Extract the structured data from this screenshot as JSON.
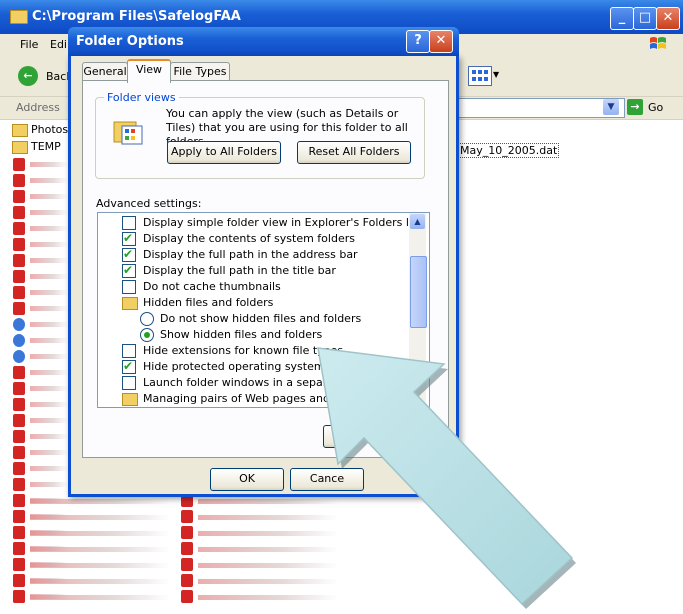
{
  "explorer": {
    "title": "C:\\Program Files\\SafelogFAA",
    "menu": [
      "File",
      "Edi"
    ],
    "toolbar": {
      "back_label": "Back"
    },
    "address_label": "Address",
    "go_label": "Go",
    "folders": [
      "Photos",
      "TEMP"
    ],
    "visible_file": "May_10_2005.dat"
  },
  "dialog": {
    "title": "Folder Options",
    "help_glyph": "?",
    "close_glyph": "✕",
    "tabs": [
      "General",
      "View",
      "File Types"
    ],
    "active_tab": "View",
    "folder_views": {
      "legend": "Folder views",
      "description": "You can apply the view (such as Details or Tiles) that you are using for this folder to all folders.",
      "apply_button": "Apply to All Folders",
      "reset_button": "Reset All Folders"
    },
    "advanced_label": "Advanced settings:",
    "settings": [
      {
        "text": "Display simple folder view in Explorer's Folders list",
        "kind": "checkbox",
        "checked": false
      },
      {
        "text": "Display the contents of system folders",
        "kind": "checkbox",
        "checked": true
      },
      {
        "text": "Display the full path in the address bar",
        "kind": "checkbox",
        "checked": true
      },
      {
        "text": "Display the full path in the title bar",
        "kind": "checkbox",
        "checked": true
      },
      {
        "text": "Do not cache thumbnails",
        "kind": "checkbox",
        "checked": false
      },
      {
        "text": "Hidden files and folders",
        "kind": "folder"
      },
      {
        "text": "Do not show hidden files and folders",
        "kind": "radio",
        "checked": false
      },
      {
        "text": "Show hidden files and folders",
        "kind": "radio",
        "checked": true
      },
      {
        "text": "Hide extensions for known file types",
        "kind": "checkbox",
        "checked": false
      },
      {
        "text": "Hide protected operating system files",
        "kind": "checkbox",
        "checked": true
      },
      {
        "text": "Launch folder windows in a separate",
        "kind": "checkbox",
        "checked": false
      },
      {
        "text": "Managing pairs of Web pages and fol",
        "kind": "folder"
      }
    ],
    "ok_label": "OK",
    "cancel_label": "Cance"
  },
  "colors": {
    "xp_blue": "#0d4ac4",
    "dialog_face": "#ece9d8",
    "arrow_fill": "#bfe3e8",
    "check_green": "#21a121"
  }
}
